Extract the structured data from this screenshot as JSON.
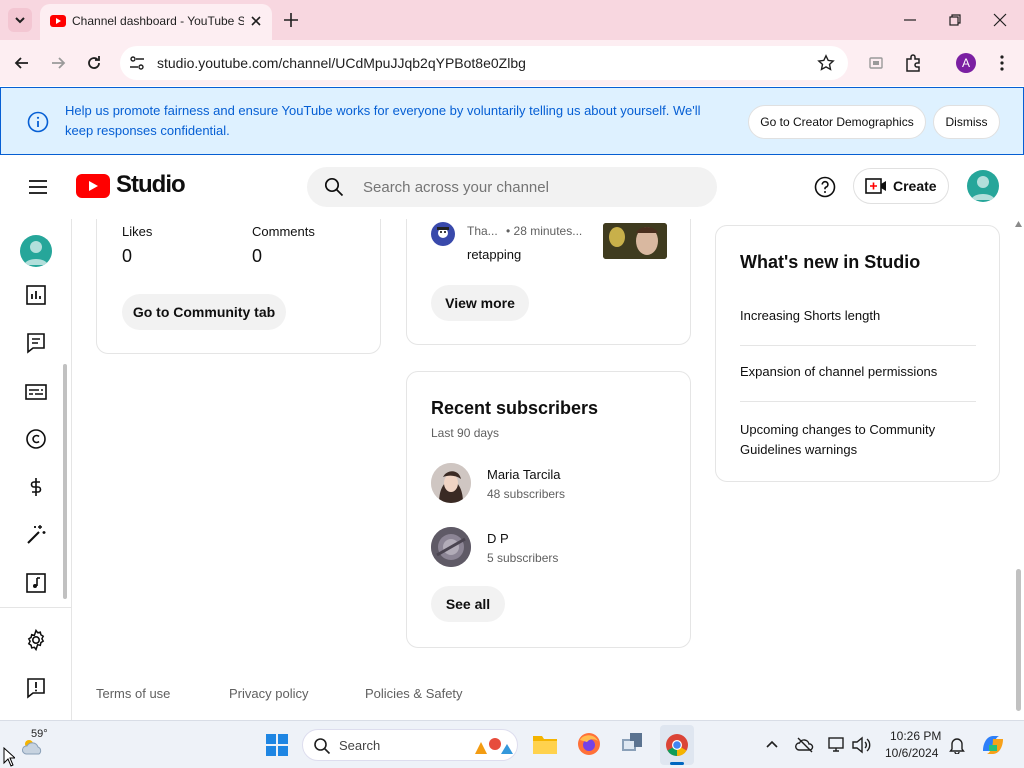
{
  "browser": {
    "tab_title": "Channel dashboard - YouTube Studio",
    "url": "studio.youtube.com/channel/UCdMpuJJqb2qYPBot8e0Zlbg",
    "profile_initial": "A"
  },
  "banner": {
    "message": "Help us promote fairness and ensure YouTube works for everyone by voluntarily telling us about yourself. We'll keep responses confidential.",
    "primary_button": "Go to Creator Demographics",
    "dismiss_button": "Dismiss"
  },
  "header": {
    "logo_text": "Studio",
    "search_placeholder": "Search across your channel",
    "create_label": "Create"
  },
  "community_card": {
    "likes_label": "Likes",
    "likes_value": "0",
    "comments_label": "Comments",
    "comments_value": "0",
    "button": "Go to Community tab"
  },
  "comment_card": {
    "author": "Tha...",
    "time": "• 28 minutes...",
    "text": "retapping",
    "button": "View more"
  },
  "subscribers_card": {
    "title": "Recent subscribers",
    "period": "Last 90 days",
    "items": [
      {
        "name": "Maria Tarcila",
        "count": "48 subscribers"
      },
      {
        "name": "D P",
        "count": "5 subscribers"
      }
    ],
    "button": "See all"
  },
  "whats_new": {
    "title": "What's new in Studio",
    "items": [
      "Increasing Shorts length",
      "Expansion of channel permissions",
      "Upcoming changes to Community Guidelines warnings"
    ]
  },
  "footer": {
    "links": [
      "Terms of use",
      "Privacy policy",
      "Policies & Safety"
    ]
  },
  "taskbar": {
    "weather_temp": "59°",
    "search_label": "Search",
    "time": "10:26 PM",
    "date": "10/6/2024"
  },
  "colors": {
    "youtube_red": "#ff0000",
    "banner_blue": "#065fd4",
    "avatar_teal": "#26a69a"
  }
}
